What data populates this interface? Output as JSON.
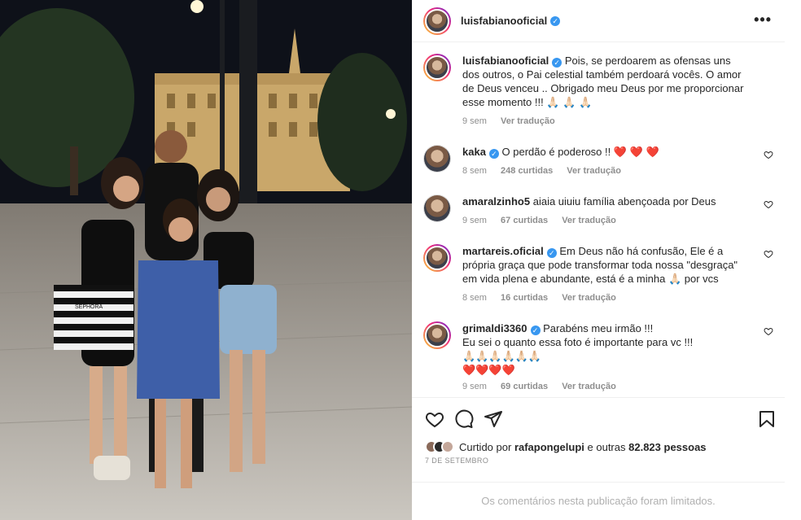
{
  "post": {
    "author": "luisfabianooficial",
    "more_label": "•••"
  },
  "caption": {
    "username": "luisfabianooficial",
    "text": "Pois, se perdoarem as ofensas uns dos outros, o Pai celestial também perdoará vocês. O amor de Deus venceu .. Obrigado meu Deus por me proporcionar esse momento !!!",
    "emoji": "🙏🏻 🙏🏻 🙏🏻",
    "time": "9 sem",
    "translate": "Ver tradução"
  },
  "comments": [
    {
      "username": "kaka",
      "verified": true,
      "text": "O perdão é poderoso !!",
      "emoji": "❤️ ❤️ ❤️",
      "time": "8 sem",
      "likes": "248 curtidas",
      "translate": "Ver tradução"
    },
    {
      "username": "amaralzinho5",
      "verified": false,
      "text": "aiaia uiuiu família abençoada por Deus",
      "time": "9 sem",
      "likes": "67 curtidas",
      "translate": "Ver tradução"
    },
    {
      "username": "martareis.oficial",
      "verified": true,
      "text": "Em Deus não há confusão, Ele é a própria graça que pode transformar toda nossa \"desgraça\" em vida plena e abundante, está é a minha",
      "emoji": "🙏🏻",
      "text_end": "por vcs",
      "time": "8 sem",
      "likes": "16 curtidas",
      "translate": "Ver tradução"
    },
    {
      "username": "grimaldi3360",
      "verified": true,
      "text": "Parabéns meu irmão !!!",
      "text_line2": "Eu sei o quanto essa foto é importante para vc !!!",
      "emoji_line3": "🙏🏻🙏🏻🙏🏻🙏🏻🙏🏻🙏🏻",
      "emoji_line4": "❤️❤️❤️❤️",
      "time": "9 sem",
      "likes": "69 curtidas",
      "translate": "Ver tradução"
    }
  ],
  "likes": {
    "prefix": "Curtido por",
    "user": "rafapongelupi",
    "middle": "e outras",
    "count": "82.823 pessoas"
  },
  "date": "7 DE SETEMBRO",
  "limited_notice": "Os comentários nesta publicação foram limitados.",
  "photo": {
    "bag_text": "SEPHORA"
  },
  "icons": {
    "like": "heart-outline-icon",
    "comment": "comment-bubble-icon",
    "share": "paper-plane-icon",
    "save": "bookmark-icon",
    "verified": "verified-badge-icon"
  },
  "colors": {
    "verified": "#3897f0",
    "muted": "#8e8e8e",
    "heart_red": "#ed4956"
  }
}
